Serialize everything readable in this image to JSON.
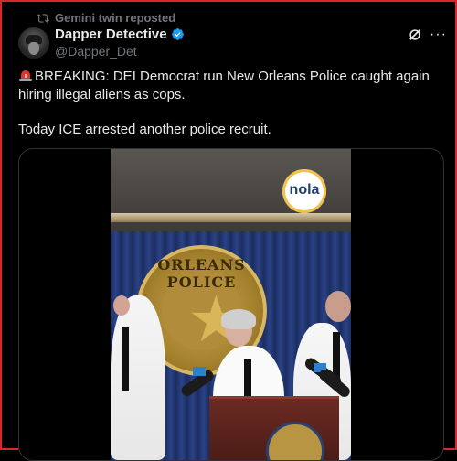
{
  "repost": {
    "label": "Gemini twin reposted",
    "icon": "repost-icon"
  },
  "author": {
    "display_name": "Dapper Detective",
    "handle": "@Dapper_Det",
    "verified": true,
    "verified_color": "#1d9bf0"
  },
  "actions": {
    "grok_icon": "grok-icon",
    "more_label": "···"
  },
  "post": {
    "emoji": "siren-emoji",
    "paragraph1": "BREAKING: DEI Democrat run New Orleans Police caught again hiring illegal aliens as cops.",
    "paragraph2": "Today ICE arrested another police recruit."
  },
  "media": {
    "type": "video",
    "watermark": "nola",
    "badge_text": "ORLEANS POLICE"
  },
  "colors": {
    "background": "#000000",
    "text": "#e7e9ea",
    "muted": "#71767b",
    "border": "#d8262a"
  }
}
